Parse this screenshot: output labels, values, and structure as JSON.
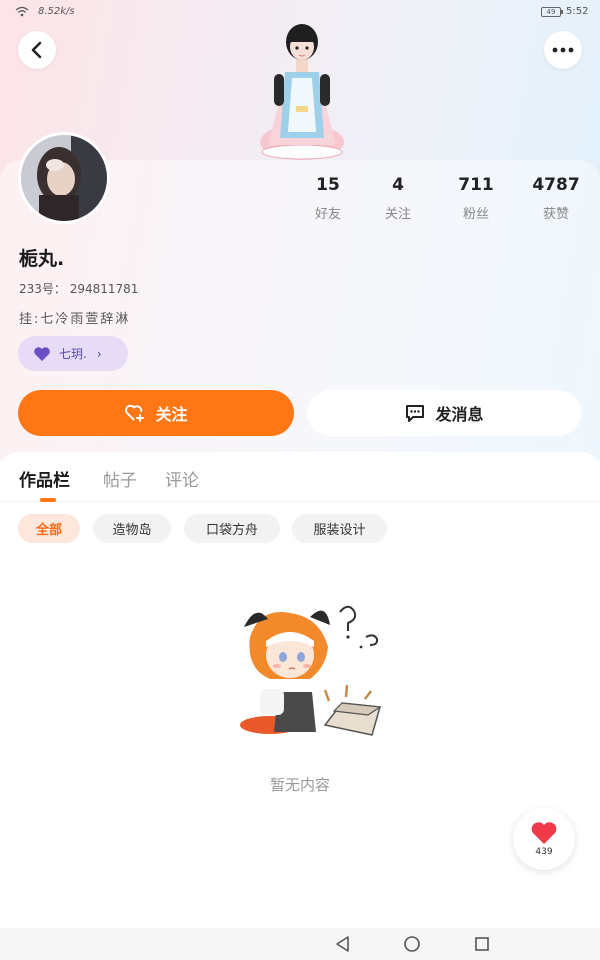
{
  "status_bar": {
    "net_speed": "8.52k/s",
    "battery": "49",
    "time": "5:52"
  },
  "header": {
    "back_icon": "chevron-left-icon",
    "more_icon": "more-dots-icon"
  },
  "profile": {
    "stats": [
      {
        "value": "15",
        "label": "好友"
      },
      {
        "value": "4",
        "label": "关注"
      },
      {
        "value": "711",
        "label": "粉丝"
      },
      {
        "value": "4787",
        "label": "获赞"
      }
    ],
    "username": "栀丸.",
    "uid": "233号： 294811781",
    "signature": "挂:七冷雨萱辞淋",
    "guild": {
      "name": "七玥.",
      "icon": "heart-icon"
    }
  },
  "actions": {
    "follow_label": "关注",
    "message_label": "发消息"
  },
  "tabs": [
    {
      "label": "作品栏",
      "active": true
    },
    {
      "label": "帖子",
      "active": false
    },
    {
      "label": "评论",
      "active": false
    }
  ],
  "filters": [
    {
      "label": "全部",
      "active": true
    },
    {
      "label": "造物岛",
      "active": false
    },
    {
      "label": "口袋方舟",
      "active": false
    },
    {
      "label": "服装设计",
      "active": false
    }
  ],
  "empty_state": {
    "text": "暂无内容"
  },
  "like_fab": {
    "count": "439"
  },
  "colors": {
    "accent": "#ff7615",
    "guild_bg": "#e6dcf6",
    "like_red": "#f03a4a"
  }
}
